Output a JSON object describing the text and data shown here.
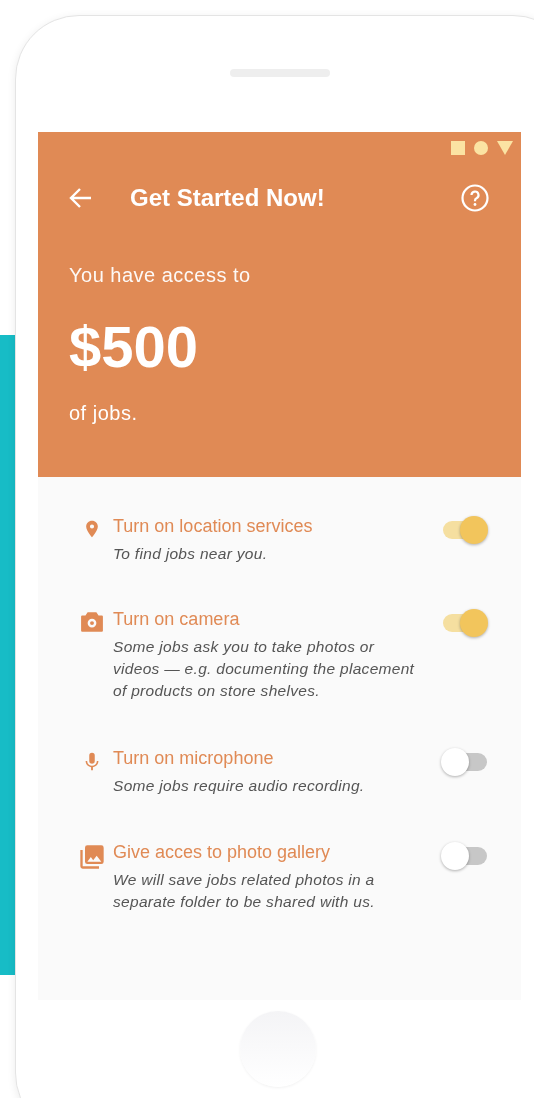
{
  "header": {
    "title": "Get Started Now!",
    "intro": "You have access to",
    "amount": "$500",
    "suffix": "of jobs."
  },
  "permissions": [
    {
      "kind": "location",
      "title": "Turn on location services",
      "description": "To find jobs near you.",
      "on": true
    },
    {
      "kind": "camera",
      "title": "Turn on camera",
      "description": "Some jobs ask you to take photos or videos — e.g. documenting the placement of products on store shelves.",
      "on": true
    },
    {
      "kind": "microphone",
      "title": "Turn on microphone",
      "description": "Some jobs require audio recording.",
      "on": false
    },
    {
      "kind": "gallery",
      "title": "Give acces to photo gallery",
      "description": "We will save jobs related photos in a separate folder to be shared with us.",
      "on": false
    }
  ]
}
